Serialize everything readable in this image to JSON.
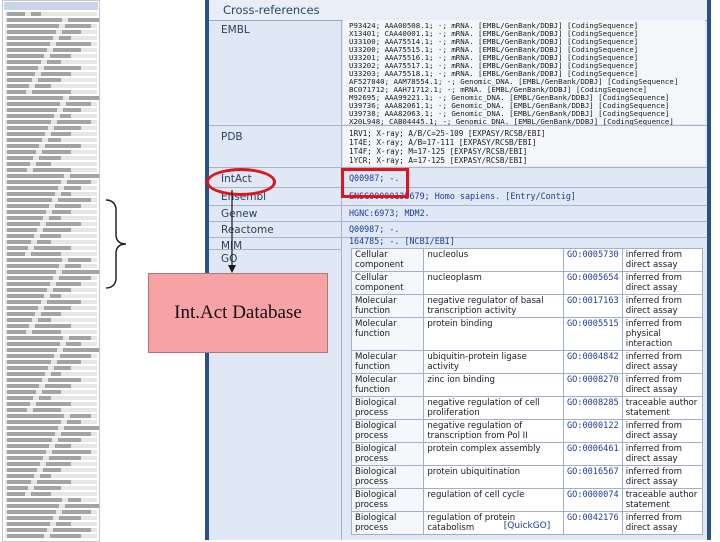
{
  "section_title": "Cross-references",
  "labels": {
    "embl": "EMBL",
    "pdb": "PDB",
    "intact": "IntAct",
    "ensembl": "Ensembl",
    "genew": "Genew",
    "reactome": "Reactome",
    "mim": "MIM",
    "go": "GO"
  },
  "embl_rows": [
    "P93424; AAA00508.1; -; mRNA. [EMBL/GenBank/DDBJ] [CodingSequence]",
    "X13401; CAA40001.1; -; mRNA. [EMBL/GenBank/DDBJ] [CodingSequence]",
    "U33100; AAA75514.1; -; mRNA. [EMBL/GenBank/DDBJ] [CodingSequence]",
    "U33200; AAA75515.1; -; mRNA. [EMBL/GenBank/DDBJ] [CodingSequence]",
    "U33201; AAA75516.1; -; mRNA. [EMBL/GenBank/DDBJ] [CodingSequence]",
    "U33202; AAA75517.1; -; mRNA. [EMBL/GenBank/DDBJ] [CodingSequence]",
    "U33203; AAA75518.1; -; mRNA. [EMBL/GenBank/DDBJ] [CodingSequence]",
    "AF527840; AAM78554.1; -; Genomic_DNA. [EMBL/GenBank/DDBJ] [CodingSequence]",
    "BC071712; AAH71712.1; -; mRNA. [EMBL/GenBank/DDBJ] [CodingSequence]",
    "M92695; AAA99221.1; -; Genomic_DNA. [EMBL/GenBank/DDBJ] [CodingSequence]",
    "U39736; AAA82061.1; -; Genomic_DNA. [EMBL/GenBank/DDBJ] [CodingSequence]",
    "U39738; AAA82063.1; -; Genomic_DNA. [EMBL/GenBank/DDBJ] [CodingSequence]",
    "X20L948; CAB04445.1; -; Genomic_DNA. [EMBL/GenBank/DDBJ] [CodingSequence]"
  ],
  "pdb_rows": [
    "1RV1; X-ray; A/B/C=25-109 [EXPASY/RCSB/EBI]",
    "1T4E; X-ray; A/B=17-111 [EXPASY/RCSB/EBI]",
    "1T4F; X-ray; M=17-125 [EXPASY/RCSB/EBI]",
    "1YCR; X-ray; A=17-125 [EXPASY/RCSB/EBI]"
  ],
  "intact_value": "Q00987; -.",
  "ensembl_value": "ENSG00000135679; Homo sapiens. [Entry/Contig]",
  "genew_value": "HGNC:6973; MDM2.",
  "reactome_value": "Q00987; -.",
  "mim_value": "164785; -. [NCBI/EBI]",
  "go_rows": [
    {
      "cat": "Cellular component",
      "term": "nucleolus",
      "id": "GO:0005730",
      "ev": "inferred from direct assay"
    },
    {
      "cat": "Cellular component",
      "term": "nucleoplasm",
      "id": "GO:0005654",
      "ev": "inferred from direct assay"
    },
    {
      "cat": "Molecular function",
      "term": "negative regulator of basal transcription activity",
      "id": "GO:0017163",
      "ev": "inferred from direct assay"
    },
    {
      "cat": "Molecular function",
      "term": "protein binding",
      "id": "GO:0005515",
      "ev": "inferred from physical interaction"
    },
    {
      "cat": "Molecular function",
      "term": "ubiquitin-protein ligase activity",
      "id": "GO:0004842",
      "ev": "inferred from direct assay"
    },
    {
      "cat": "Molecular function",
      "term": "zinc ion binding",
      "id": "GO:0008270",
      "ev": "inferred from direct assay"
    },
    {
      "cat": "Biological process",
      "term": "negative regulation of cell proliferation",
      "id": "GO:0008285",
      "ev": "traceable author statement"
    },
    {
      "cat": "Biological process",
      "term": "negative regulation of transcription from Pol II",
      "id": "GO:0000122",
      "ev": "inferred from direct assay"
    },
    {
      "cat": "Biological process",
      "term": "protein complex assembly",
      "id": "GO:0006461",
      "ev": "inferred from direct assay"
    },
    {
      "cat": "Biological process",
      "term": "protein ubiquitination",
      "id": "GO:0016567",
      "ev": "inferred from direct assay"
    },
    {
      "cat": "Biological process",
      "term": "regulation of cell cycle",
      "id": "GO:0000074",
      "ev": "traceable author statement"
    },
    {
      "cat": "Biological process",
      "term": "regulation of protein catabolism",
      "id": "GO:0042176",
      "ev": "inferred from direct assay"
    }
  ],
  "go_footer": "[QuickGO]",
  "callout_text": "Int.Act Database",
  "colors": {
    "highlight": "#e0141a",
    "callout_bg": "#f7a3a6",
    "panel_border": "#2c4f86"
  }
}
